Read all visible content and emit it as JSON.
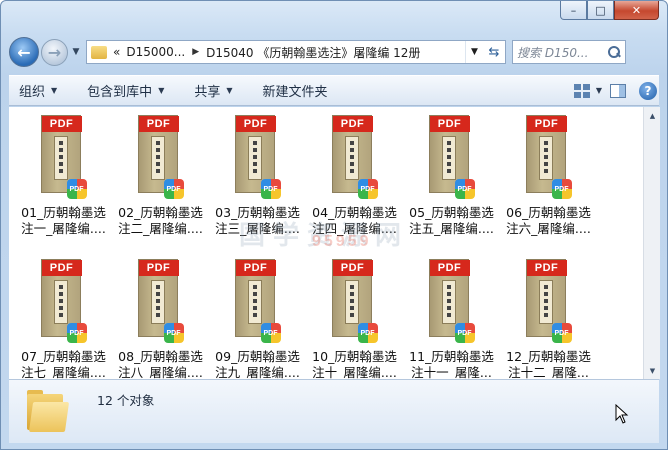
{
  "window": {
    "controls": {
      "minimize": "–",
      "maximize": "□",
      "close": "✕"
    }
  },
  "nav": {
    "back_icon": "back-arrow-icon",
    "forward_icon": "forward-arrow-icon",
    "address": {
      "overflow": "«",
      "crumbs": [
        "D15000...",
        "D15040 《历朝翰墨选注》屠隆编 12册"
      ]
    },
    "search_placeholder": "搜索 D150..."
  },
  "toolbar": {
    "organize": "组织",
    "include_in_library": "包含到库中",
    "share": "共享",
    "new_folder": "新建文件夹"
  },
  "files": [
    {
      "line1": "01_历朝翰墨选",
      "line2": "注一_屠隆编...."
    },
    {
      "line1": "02_历朝翰墨选",
      "line2": "注二_屠隆编...."
    },
    {
      "line1": "03_历朝翰墨选",
      "line2": "注三_屠隆编...."
    },
    {
      "line1": "04_历朝翰墨选",
      "line2": "注四_屠隆编...."
    },
    {
      "line1": "05_历朝翰墨选",
      "line2": "注五_屠隆编...."
    },
    {
      "line1": "06_历朝翰墨选",
      "line2": "注六_屠隆编...."
    },
    {
      "line1": "07_历朝翰墨选",
      "line2": "注七_屠隆编...."
    },
    {
      "line1": "08_历朝翰墨选",
      "line2": "注八_屠隆编...."
    },
    {
      "line1": "09_历朝翰墨选",
      "line2": "注九_屠隆编...."
    },
    {
      "line1": "10_历朝翰墨选",
      "line2": "注十_屠隆编...."
    },
    {
      "line1": "11_历朝翰墨选",
      "line2": "注十一_屠隆..."
    },
    {
      "line1": "12_历朝翰墨选",
      "line2": "注十二_屠隆..."
    }
  ],
  "thumb": {
    "band_label": "PDF",
    "badge_label": "PDF"
  },
  "watermark": {
    "text": "国学资源网",
    "number": "95959"
  },
  "details": {
    "count": "12 个对象"
  },
  "colors": {
    "pdf_red": "#d6281c",
    "accent": "#2a6bb6"
  }
}
